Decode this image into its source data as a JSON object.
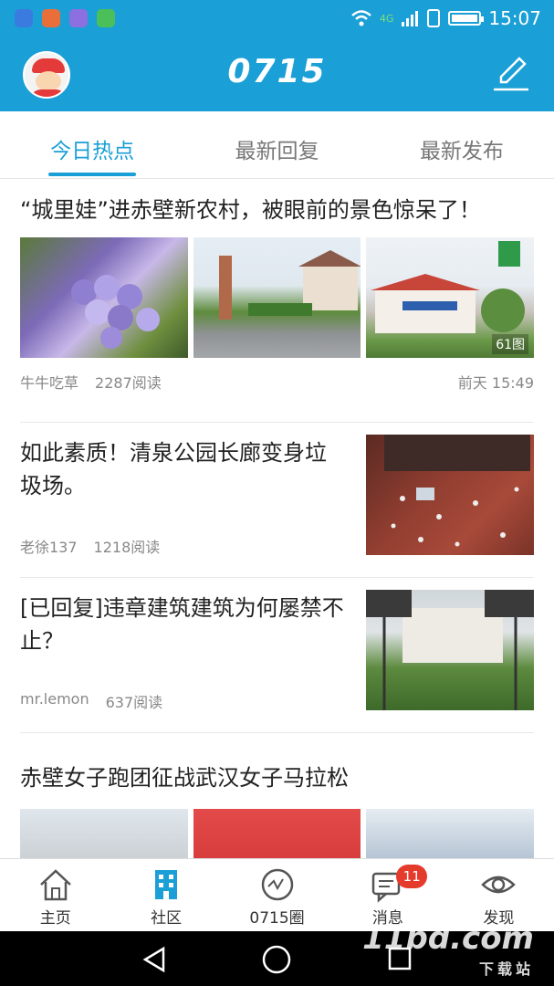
{
  "status_bar": {
    "network": "4G",
    "time": "15:07"
  },
  "header": {
    "brand": "0715",
    "avatar_icon": "user-avatar-icon",
    "edit_icon": "edit-icon"
  },
  "tabs": [
    {
      "label": "今日热点",
      "active": true
    },
    {
      "label": "最新回复",
      "active": false
    },
    {
      "label": "最新发布",
      "active": false
    }
  ],
  "posts": [
    {
      "title": "“城里娃”进赤壁新农村，被眼前的景色惊呆了！",
      "author": "牛牛吃草",
      "reads": "2287阅读",
      "time": "前天 15:49",
      "image_count": "61图"
    },
    {
      "title": "如此素质！清泉公园长廊变身垃圾场。",
      "author": "老徐137",
      "reads": "1218阅读"
    },
    {
      "title": "[已回复]违章建筑建筑为何屡禁不止？",
      "author": "mr.lemon",
      "reads": "637阅读"
    },
    {
      "title": "赤壁女子跑团征战武汉女子马拉松"
    }
  ],
  "bottom_nav": [
    {
      "label": "主页",
      "icon": "home-icon"
    },
    {
      "label": "社区",
      "icon": "community-icon",
      "active": true
    },
    {
      "label": "0715圈",
      "icon": "circle-icon"
    },
    {
      "label": "消息",
      "icon": "message-icon",
      "badge": "11"
    },
    {
      "label": "发现",
      "icon": "discover-eye-icon"
    }
  ],
  "watermark": {
    "main": "11bd.com",
    "sub": "下载站"
  },
  "colors": {
    "primary": "#1a9fd6",
    "badge": "#e53b2c"
  }
}
